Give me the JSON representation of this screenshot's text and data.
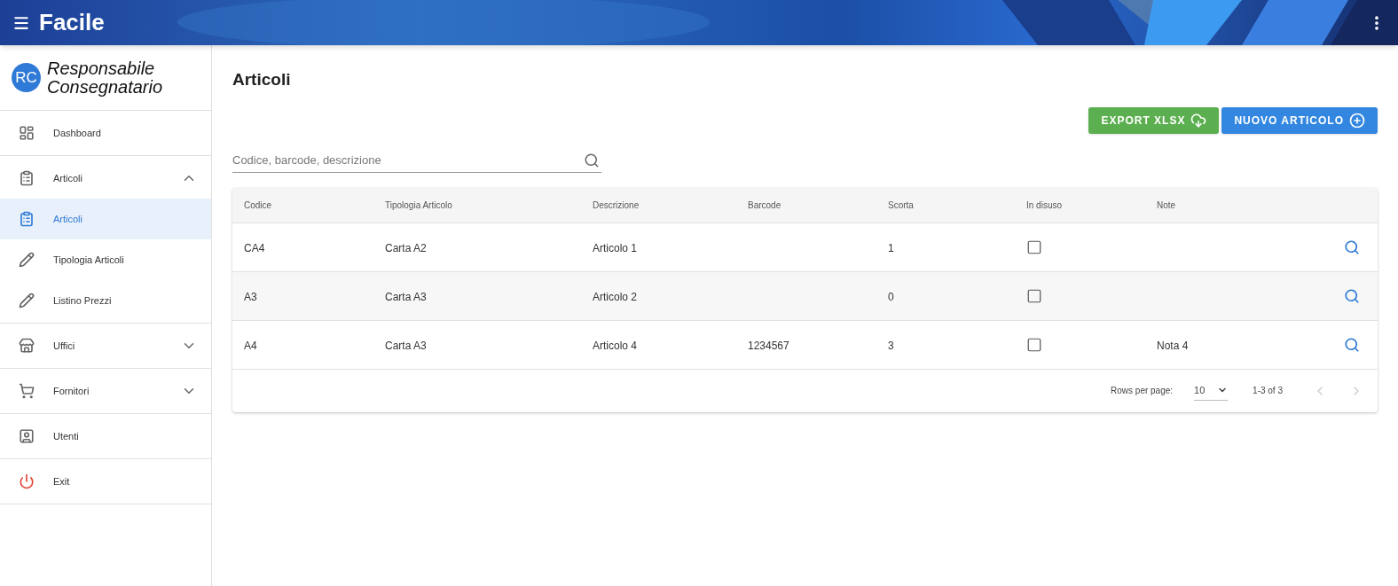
{
  "app_bar": {
    "title": "Facile"
  },
  "sidebar": {
    "brand": {
      "initials": "RC",
      "name": "Responsabile Consegnatario"
    },
    "items": [
      {
        "label": "Dashboard",
        "selected": false
      },
      {
        "label": "Articoli",
        "selected": false,
        "expanded": true,
        "children": [
          {
            "label": "Articoli",
            "selected": true
          },
          {
            "label": "Tipologia Articoli",
            "selected": false
          },
          {
            "label": "Listino Prezzi",
            "selected": false
          }
        ]
      },
      {
        "label": "Uffici",
        "selected": false,
        "expanded": false
      },
      {
        "label": "Fornitori",
        "selected": false,
        "expanded": false
      },
      {
        "label": "Utenti",
        "selected": false
      },
      {
        "label": "Exit",
        "selected": false
      }
    ]
  },
  "page": {
    "title": "Articoli",
    "buttons": [
      {
        "label": "EXPORT XLSX",
        "kind": "export"
      },
      {
        "label": "NUOVO ARTICOLO",
        "kind": "new"
      }
    ],
    "search": {
      "placeholder": "Codice, barcode, descrizione"
    }
  },
  "table": {
    "columns": [
      "Codice",
      "Tipologia Articolo",
      "Descrizione",
      "Barcode",
      "Scorta",
      "In disuso",
      "Note"
    ],
    "rows": [
      {
        "codice": "CA4",
        "tipologia": "Carta A2",
        "descrizione": "Articolo 1",
        "barcode": "",
        "scorta": "1",
        "in_disuso": false,
        "note": ""
      },
      {
        "codice": "A3",
        "tipologia": "Carta A3",
        "descrizione": "Articolo 2",
        "barcode": "",
        "scorta": "0",
        "in_disuso": false,
        "note": ""
      },
      {
        "codice": "A4",
        "tipologia": "Carta A3",
        "descrizione": "Articolo 4",
        "barcode": "1234567",
        "scorta": "3",
        "in_disuso": false,
        "note": "Nota 4"
      }
    ],
    "pagination": {
      "rows_per_page_label": "Rows per page:",
      "rows_per_page": "10",
      "range": "1-3 of 3",
      "previous_disabled": true,
      "next_disabled": true
    }
  }
}
